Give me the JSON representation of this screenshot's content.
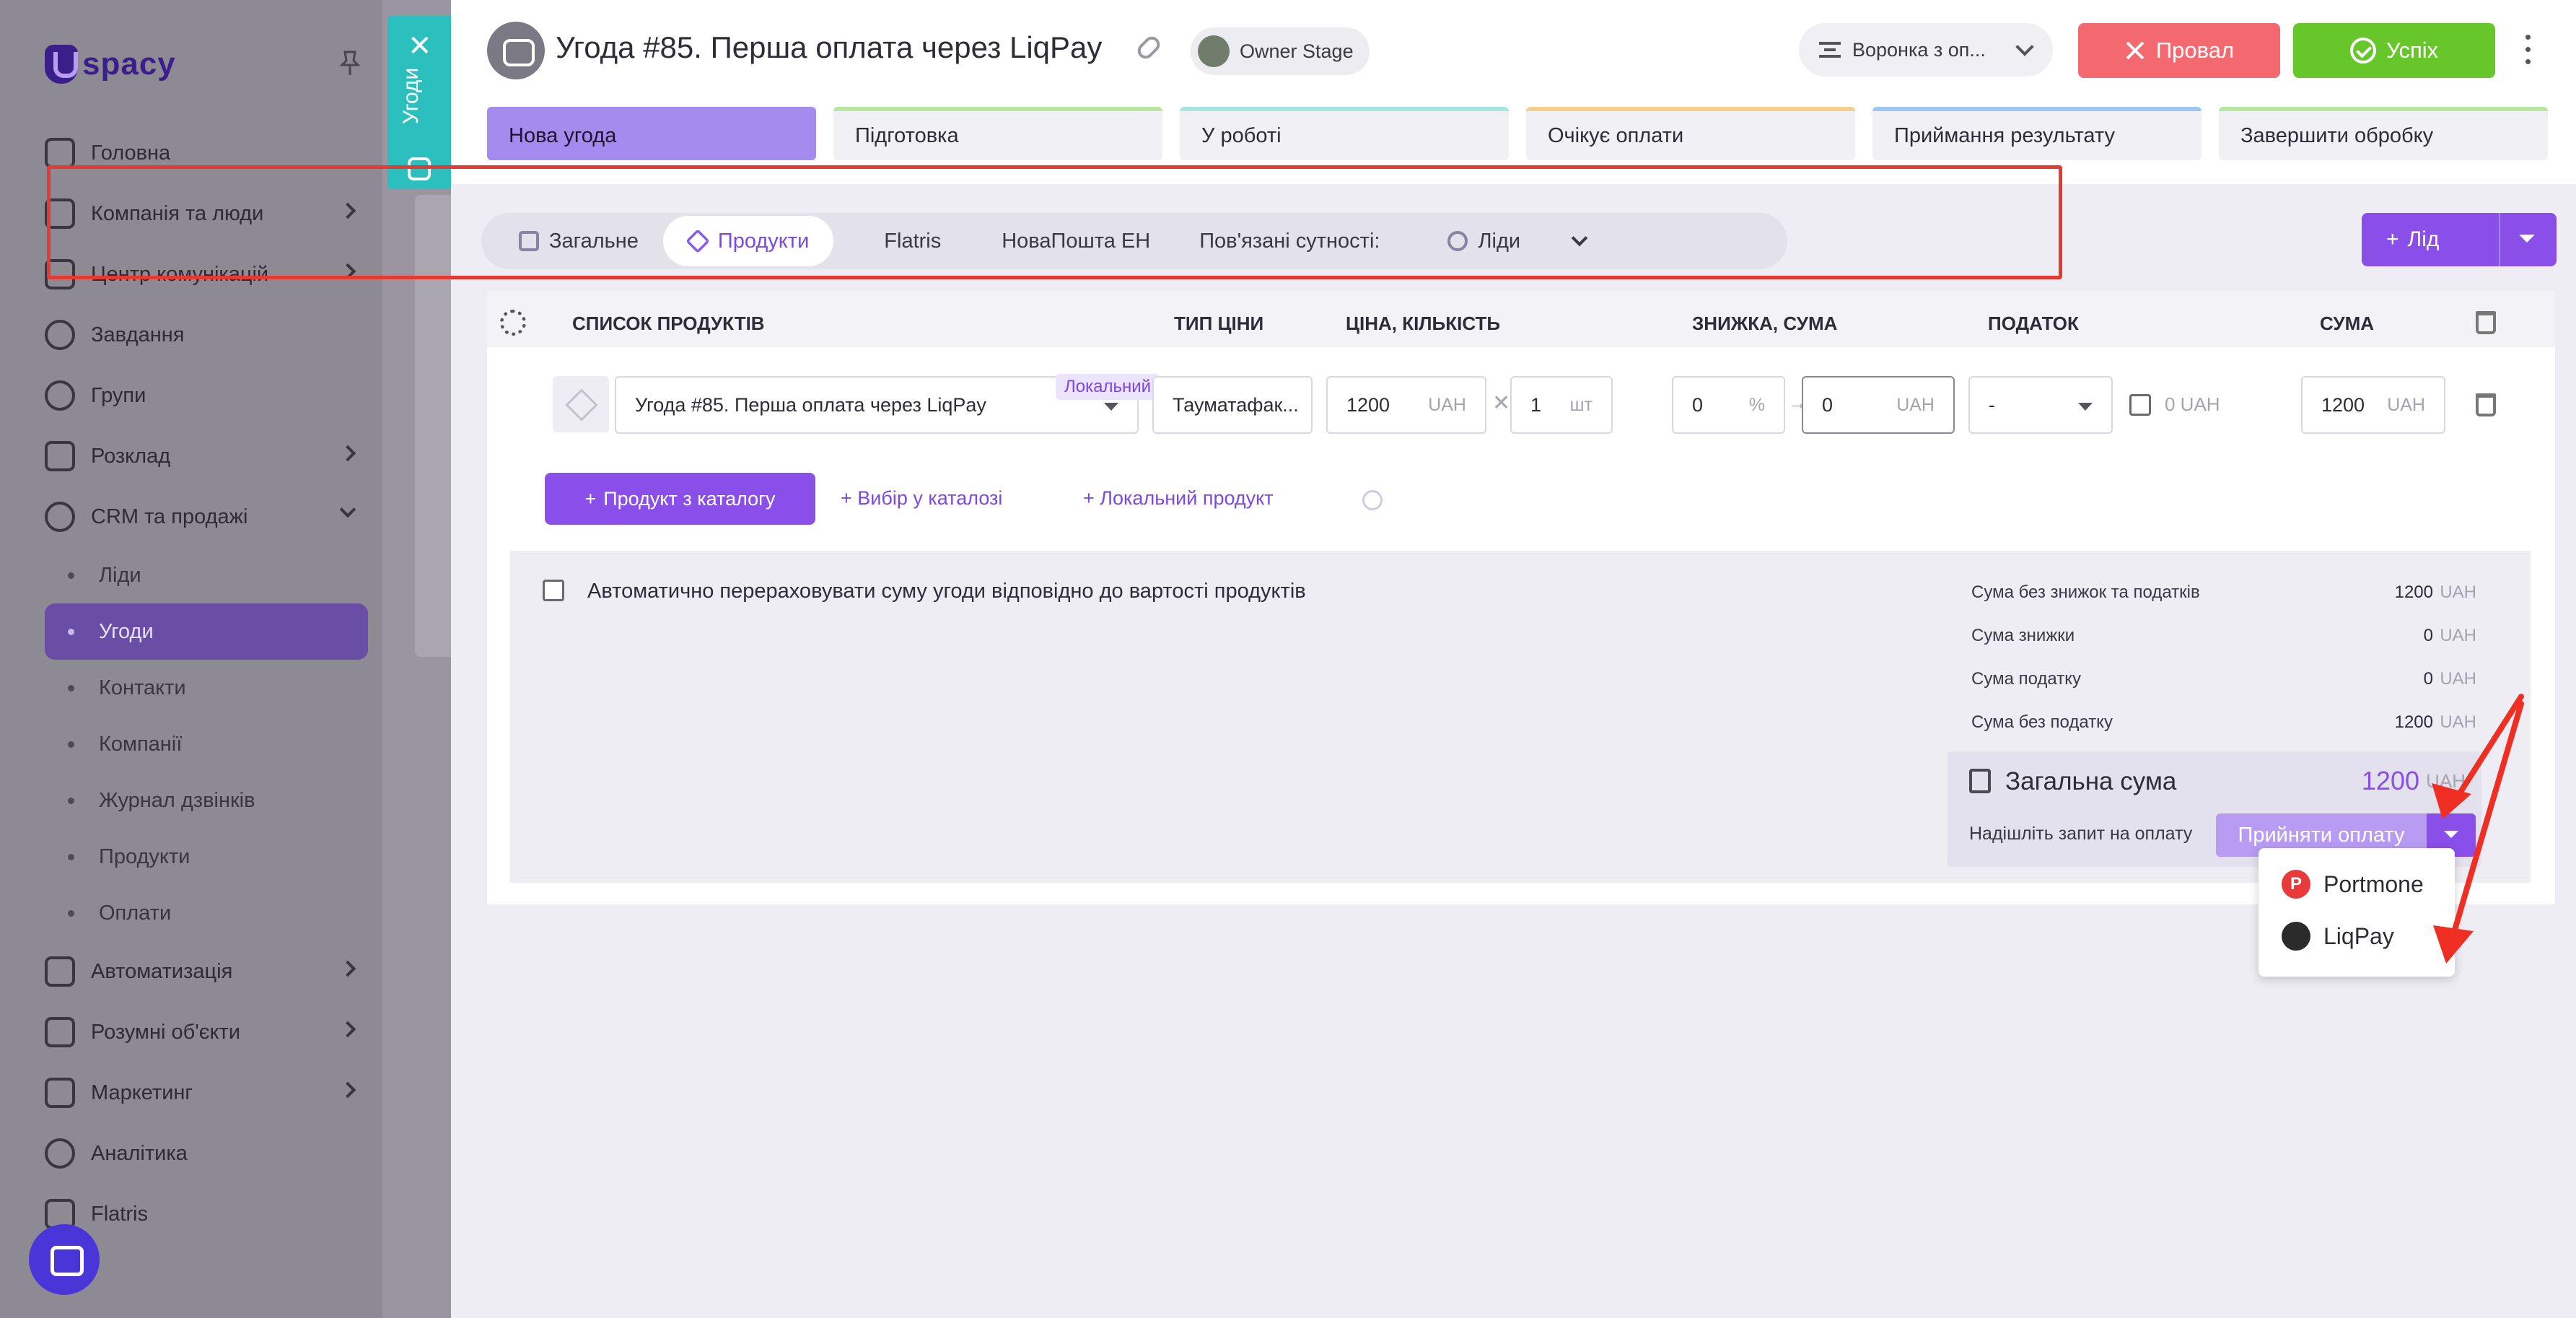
{
  "sidebar": {
    "logo_text": "spacy",
    "items": [
      {
        "label": "Головна"
      },
      {
        "label": "Компанія та люди"
      },
      {
        "label": "Центр комунікацій"
      },
      {
        "label": "Завдання"
      },
      {
        "label": "Групи"
      },
      {
        "label": "Розклад"
      },
      {
        "label": "CRM та продажі"
      }
    ],
    "crm_sub": [
      {
        "label": "Ліди"
      },
      {
        "label": "Угоди"
      },
      {
        "label": "Контакти"
      },
      {
        "label": "Компанії"
      },
      {
        "label": "Журнал дзвінків"
      },
      {
        "label": "Продукти"
      },
      {
        "label": "Оплати"
      }
    ],
    "bottom_items": [
      {
        "label": "Автоматизація"
      },
      {
        "label": "Розумні об'єкти"
      },
      {
        "label": "Маркетинг"
      },
      {
        "label": "Аналітика"
      },
      {
        "label": "Flatris"
      }
    ]
  },
  "side_tab": {
    "label": "Угоди",
    "close": "✕"
  },
  "header": {
    "title": "Угода #85. Перша оплата через LiqPay",
    "owner_chip": "Owner Stage",
    "funnel": "Воронка з оп...",
    "fail_button": "Провал",
    "success_button": "Успіх"
  },
  "stages": [
    {
      "label": "Нова угода",
      "color": "#a48cef"
    },
    {
      "label": "Підготовка",
      "color": "#b8e6a0"
    },
    {
      "label": "У роботі",
      "color": "#a8e4e2"
    },
    {
      "label": "Очікує оплати",
      "color": "#f5cf8e"
    },
    {
      "label": "Приймання результату",
      "color": "#9ec7f2"
    },
    {
      "label": "Завершити обробку",
      "color": "#b8e6a0"
    }
  ],
  "tabs": [
    {
      "label": "Загальне"
    },
    {
      "label": "Продукти"
    },
    {
      "label": "Flatris"
    },
    {
      "label": "НоваПошта ЕН"
    },
    {
      "label": "Пов'язані сутності:"
    },
    {
      "label": "Ліди"
    }
  ],
  "lead_button": "Лід",
  "products_table": {
    "headers": {
      "list": "СПИСОК ПРОДУКТІВ",
      "price_type": "ТИП ЦІНИ",
      "price_qty": "ЦІНА, КІЛЬКІСТЬ",
      "discount": "ЗНИЖКА, СУМА",
      "tax": "ПОДАТОК",
      "sum": "СУМА"
    },
    "row": {
      "name": "Угода #85. Перша оплата через LiqPay",
      "badge": "Локальний",
      "price_type": "Тауматафак...",
      "price": "1200",
      "price_unit": "UAH",
      "times": "✕",
      "qty": "1",
      "qty_unit": "шт",
      "discount_pct": "0",
      "pct_unit": "%",
      "arrow": "→",
      "discount_sum": "0",
      "discount_unit": "UAH",
      "tax": "-",
      "tax_amount": "0 UAH",
      "sum": "1200",
      "sum_unit": "UAH"
    }
  },
  "actions": {
    "add_from_catalog": "Продукт з каталогу",
    "pick_in_catalog": "Вибір у каталозі",
    "local_product": "Локальний продукт"
  },
  "summary": {
    "auto_recalc": "Автоматично перераховувати суму угоди відповідно до вартості продуктів",
    "rows": [
      {
        "label": "Сума без знижок та податків",
        "value": "1200",
        "unit": "UAH"
      },
      {
        "label": "Сума знижки",
        "value": "0",
        "unit": "UAH"
      },
      {
        "label": "Сума податку",
        "value": "0",
        "unit": "UAH"
      },
      {
        "label": "Сума без податку",
        "value": "1200",
        "unit": "UAH"
      }
    ],
    "total_label": "Загальна сума",
    "total_value": "1200",
    "total_unit": "UAH",
    "request_label": "Надішліть запит на оплату",
    "accept_button": "Прийняти оплату"
  },
  "payment_dropdown": [
    {
      "label": "Portmone"
    },
    {
      "label": "LiqPay"
    }
  ]
}
